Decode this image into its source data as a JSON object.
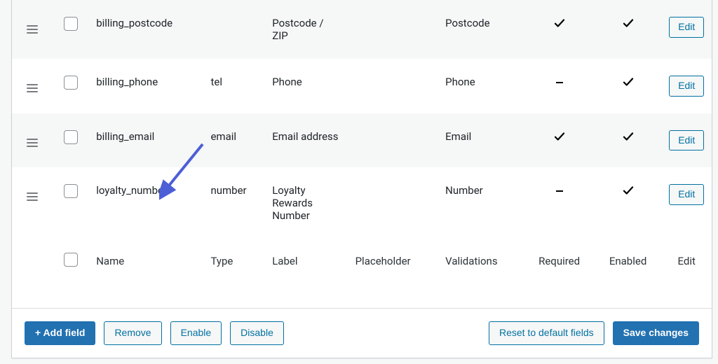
{
  "columns": {
    "name": "Name",
    "type": "Type",
    "label": "Label",
    "placeholder": "Placeholder",
    "validations": "Validations",
    "required": "Required",
    "enabled": "Enabled",
    "edit": "Edit"
  },
  "rows": [
    {
      "name": "billing_postcode",
      "type": "",
      "label": "Postcode / ZIP",
      "placeholder": "",
      "validations": "Postcode",
      "required": "check",
      "enabled": "check",
      "alt": true
    },
    {
      "name": "billing_phone",
      "type": "tel",
      "label": "Phone",
      "placeholder": "",
      "validations": "Phone",
      "required": "dash",
      "enabled": "check",
      "alt": false
    },
    {
      "name": "billing_email",
      "type": "email",
      "label": "Email address",
      "placeholder": "",
      "validations": "Email",
      "required": "check",
      "enabled": "check",
      "alt": true
    },
    {
      "name": "loyalty_number",
      "type": "number",
      "label": "Loyalty Rewards Number",
      "placeholder": "",
      "validations": "Number",
      "required": "dash",
      "enabled": "check",
      "alt": false
    }
  ],
  "buttons": {
    "add_field": "+ Add field",
    "remove": "Remove",
    "enable": "Enable",
    "disable": "Disable",
    "reset": "Reset to default fields",
    "save": "Save changes",
    "edit": "Edit"
  }
}
